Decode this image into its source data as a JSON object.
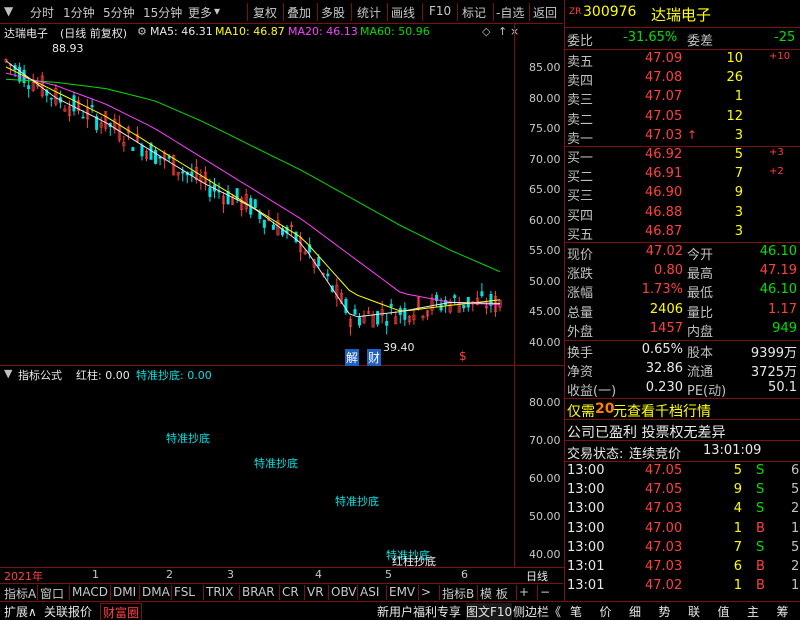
{
  "toolbar": {
    "left": [
      "分时",
      "1分钟",
      "5分钟",
      "15分钟",
      "更多"
    ],
    "right": [
      "复权",
      "叠加",
      "多股",
      "统计",
      "画线",
      "F10",
      "标记",
      "-自选",
      "返回"
    ]
  },
  "chart": {
    "stock_name": "达瑞电子",
    "mode": "(日线 前复权)",
    "ma5": "MA5: 46.31",
    "ma10": "MA10: 46.87",
    "ma20": "MA20: 46.13",
    "ma60": "MA60: 50.96",
    "high_label": "88.93",
    "low_label": "39.40",
    "marker_jie": "解",
    "marker_cai": "财",
    "marker_s": "$",
    "yticks": [
      "85.00",
      "80.00",
      "75.00",
      "70.00",
      "65.00",
      "60.00",
      "55.00",
      "50.00",
      "45.00",
      "40.00"
    ],
    "colors": {
      "ma5": "#e8e8e8",
      "ma10": "#ffff00",
      "ma20": "#ff40ff",
      "ma60": "#00e000",
      "up": "#ff4040",
      "down": "#00e0e0"
    }
  },
  "chart_data": {
    "type": "line",
    "title": "达瑞电子 (日线 前复权)",
    "x": [
      "2021年",
      "1",
      "2",
      "3",
      "4",
      "5",
      "6"
    ],
    "series": [
      {
        "name": "MA60",
        "values": [
          83,
          82.5,
          81.5,
          79.5,
          76,
          72,
          68,
          63.5,
          59,
          55,
          51.5
        ]
      },
      {
        "name": "MA20",
        "values": [
          84,
          82,
          79,
          75,
          70,
          65,
          60,
          54,
          48,
          46.5,
          46.1
        ]
      },
      {
        "name": "MA10",
        "values": [
          85,
          81,
          77,
          72,
          67,
          62,
          57,
          48,
          45,
          46,
          46.9
        ]
      },
      {
        "name": "MA5",
        "values": [
          86,
          80,
          76,
          71,
          66,
          62,
          56,
          44,
          45,
          46.5,
          46.3
        ]
      }
    ],
    "ylim": [
      38,
      88
    ],
    "annotations": [
      "88.93",
      "39.40"
    ]
  },
  "indicator": {
    "title": "指标公式",
    "hongzhu": "红柱: 0.00",
    "tezhun": "特准抄底: 0.00",
    "labels": [
      "特准抄底",
      "特准抄底",
      "特准抄底",
      "特准抄底",
      "红柱抄底"
    ],
    "yticks": [
      "80.00",
      "70.00",
      "60.00",
      "50.00",
      "40.00"
    ]
  },
  "xaxis": {
    "year": "2021年",
    "months": [
      "1",
      "2",
      "3",
      "4",
      "5",
      "6"
    ],
    "period": "日线"
  },
  "bottom_tabs": [
    "指标A",
    "窗口",
    "MACD",
    "DMI",
    "DMA",
    "FSL",
    "TRIX",
    "BRAR",
    "CR",
    "VR",
    "OBV",
    "ASI",
    "EMV",
    ">",
    "指标B",
    "模 板",
    "+",
    "−"
  ],
  "bottom_bar2": {
    "left": [
      "扩展∧",
      "关联报价",
      "财富圈"
    ],
    "right": [
      "新用户福利专享",
      "图文F10",
      "侧边栏《"
    ],
    "right_tabs": [
      "笔",
      "价",
      "细",
      "势",
      "联",
      "值",
      "主",
      "筹"
    ]
  },
  "quote": {
    "code": "300976",
    "code_prefix": "ZR",
    "name": "达瑞电子",
    "weibi_label": "委比",
    "weibi": "-31.65%",
    "weicha_label": "委差",
    "weicha": "-25",
    "asks": [
      {
        "label": "卖五",
        "price": "47.09",
        "vol": "10",
        "chg": "+10"
      },
      {
        "label": "卖四",
        "price": "47.08",
        "vol": "26",
        "chg": ""
      },
      {
        "label": "卖三",
        "price": "47.07",
        "vol": "1",
        "chg": ""
      },
      {
        "label": "卖二",
        "price": "47.05",
        "vol": "12",
        "chg": ""
      },
      {
        "label": "卖一",
        "price": "47.03",
        "vol": "3",
        "chg": "",
        "arrow": "↑"
      }
    ],
    "bids": [
      {
        "label": "买一",
        "price": "46.92",
        "vol": "5",
        "chg": "+3"
      },
      {
        "label": "买二",
        "price": "46.91",
        "vol": "7",
        "chg": "+2"
      },
      {
        "label": "买三",
        "price": "46.90",
        "vol": "9",
        "chg": ""
      },
      {
        "label": "买四",
        "price": "46.88",
        "vol": "3",
        "chg": ""
      },
      {
        "label": "买五",
        "price": "46.87",
        "vol": "3",
        "chg": ""
      }
    ],
    "stats": [
      {
        "l1": "现价",
        "v1": "47.02",
        "l2": "今开",
        "v2": "46.10",
        "c1": "red",
        "c2": "green"
      },
      {
        "l1": "涨跌",
        "v1": "0.80",
        "l2": "最高",
        "v2": "47.19",
        "c1": "red",
        "c2": "red"
      },
      {
        "l1": "涨幅",
        "v1": "1.73%",
        "l2": "最低",
        "v2": "46.10",
        "c1": "red",
        "c2": "green"
      },
      {
        "l1": "总量",
        "v1": "2406",
        "l2": "量比",
        "v2": "1.17",
        "c1": "yellow",
        "c2": "red"
      },
      {
        "l1": "外盘",
        "v1": "1457",
        "l2": "内盘",
        "v2": "949",
        "c1": "red",
        "c2": "green"
      }
    ],
    "stats2": [
      {
        "l1": "换手",
        "v1": "0.65%",
        "l2": "股本",
        "v2": "9399万"
      },
      {
        "l1": "净资",
        "v1": "32.86",
        "l2": "流通",
        "v2": "3725万"
      },
      {
        "l1": "收益(一)",
        "v1": "0.230",
        "l2": "PE(动)",
        "v2": "50.1"
      }
    ],
    "promo": "仅需20元查看千档行情",
    "promo_pre": "仅需",
    "promo_num": "20",
    "promo_post": "元查看千档行情",
    "info": "公司已盈利 投票权无差异",
    "trade_status_label": "交易状态:",
    "trade_status": "连续竞价",
    "trade_time": "13:01:09",
    "ticks": [
      {
        "t": "13:00",
        "p": "47.05",
        "v": "5",
        "s": "S",
        "n": "6"
      },
      {
        "t": "13:00",
        "p": "47.05",
        "v": "9",
        "s": "S",
        "n": "5"
      },
      {
        "t": "13:00",
        "p": "47.03",
        "v": "4",
        "s": "S",
        "n": "2"
      },
      {
        "t": "13:00",
        "p": "47.00",
        "v": "1",
        "s": "B",
        "n": "1"
      },
      {
        "t": "13:00",
        "p": "47.03",
        "v": "7",
        "s": "S",
        "n": "5"
      },
      {
        "t": "13:01",
        "p": "47.03",
        "v": "6",
        "s": "B",
        "n": "2"
      },
      {
        "t": "13:01",
        "p": "47.02",
        "v": "1",
        "s": "B",
        "n": "1"
      }
    ]
  }
}
